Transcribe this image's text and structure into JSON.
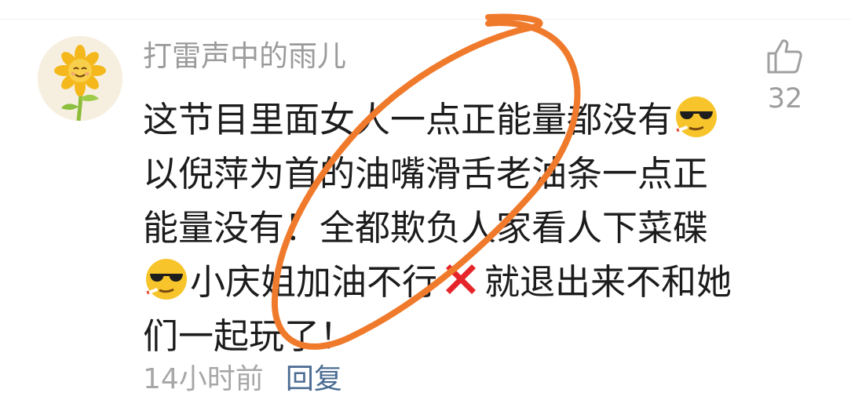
{
  "comment": {
    "username": "打雷声中的雨儿",
    "avatar_icon": "sunflower-avatar",
    "text": {
      "part1": "这节目里面女人一点正能量都没有",
      "emoji1": "cool-sunglasses-emoji",
      "part2": "以倪萍为首的油嘴滑舌老油条一点正能量没有！全都欺负人家看人下菜碟",
      "emoji2": "cool-sunglasses-emoji",
      "part3": "小庆姐加油不行",
      "emoji3": "red-cross-emoji",
      "part4": "就退出来不和她们一起玩了！"
    },
    "time": "14小时前",
    "reply_label": "回复",
    "like": {
      "icon": "thumbs-up-icon",
      "count": "32"
    }
  },
  "annotation": {
    "type": "hand-drawn-circle",
    "color": "#f07a2b"
  },
  "colors": {
    "username": "#9b9b9b",
    "text": "#1c1c1c",
    "reply": "#4a6b92",
    "meta": "#a7a7a7"
  }
}
